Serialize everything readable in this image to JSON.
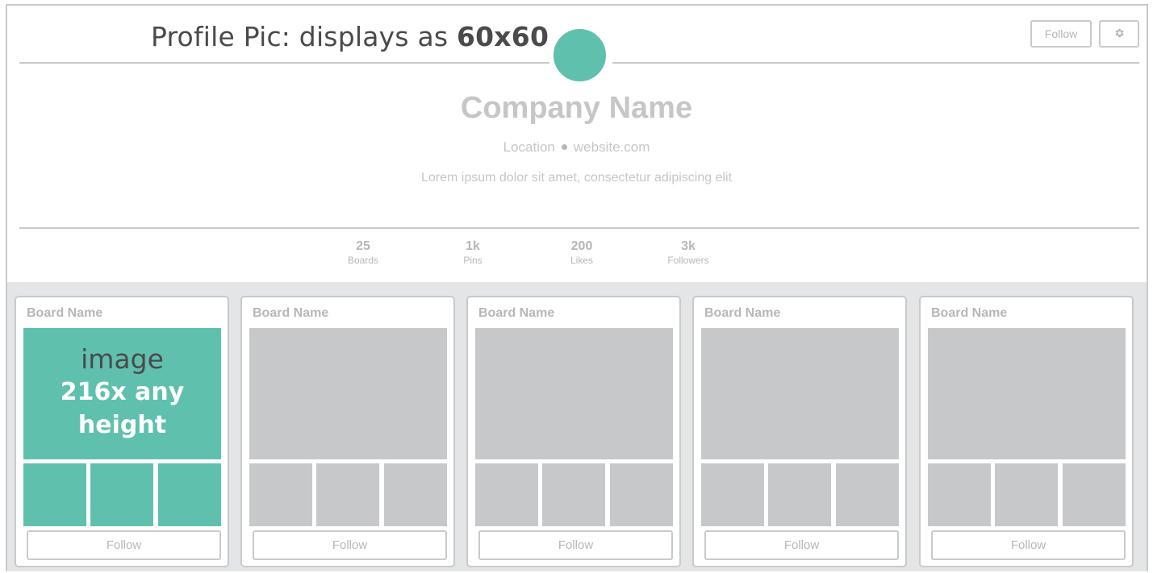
{
  "annotation": {
    "prefix": "Profile Pic: displays as ",
    "size": "60x60"
  },
  "header": {
    "follow_label": "Follow",
    "settings_icon": "gear-icon"
  },
  "profile": {
    "company_name": "Company Name",
    "location": "Location",
    "website": "website.com",
    "description": "Lorem ipsum dolor sit amet, consectetur adipiscing elit"
  },
  "stats": [
    {
      "value": "25",
      "label": "Boards"
    },
    {
      "value": "1k",
      "label": "Pins"
    },
    {
      "value": "200",
      "label": "Likes"
    },
    {
      "value": "3k",
      "label": "Followers"
    }
  ],
  "boards": [
    {
      "name": "Board Name",
      "follow_label": "Follow",
      "image_label_1": "image",
      "image_label_2": "216x any height"
    },
    {
      "name": "Board Name",
      "follow_label": "Follow"
    },
    {
      "name": "Board Name",
      "follow_label": "Follow"
    },
    {
      "name": "Board Name",
      "follow_label": "Follow"
    },
    {
      "name": "Board Name",
      "follow_label": "Follow"
    }
  ],
  "colors": {
    "accent": "#5fc1ad",
    "placeholder": "#c7c8ca",
    "border": "#c9cacb",
    "text": "#b5b7b9"
  }
}
